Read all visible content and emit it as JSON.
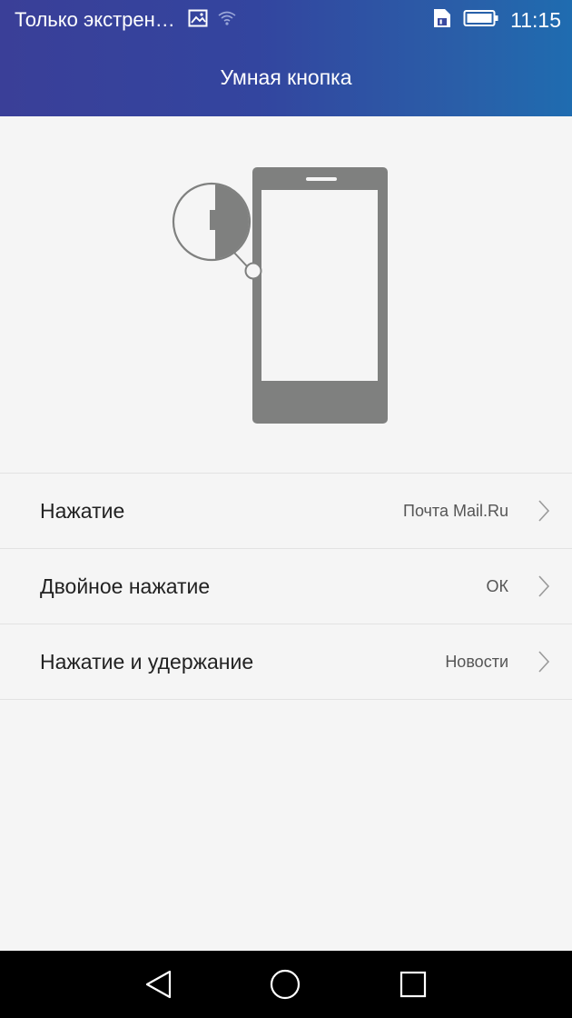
{
  "status_bar": {
    "carrier": "Только экстрен…",
    "time": "11:15",
    "icons": [
      "image-notification-icon",
      "wifi-icon",
      "sim-icon",
      "battery-icon"
    ]
  },
  "header": {
    "title": "Умная кнопка",
    "gradient_colors": [
      "#3a3f98",
      "#1f6cb0"
    ]
  },
  "illustration": {
    "icon": "phone-smart-button-illustration",
    "color": "#7f807f"
  },
  "settings": {
    "items": [
      {
        "label": "Нажатие",
        "value": "Почта Mail.Ru"
      },
      {
        "label": "Двойное нажатие",
        "value": "ОК"
      },
      {
        "label": "Нажатие и удержание",
        "value": "Новости"
      }
    ]
  },
  "navigation_bar": {
    "buttons": [
      "back-icon",
      "home-icon",
      "recents-icon"
    ]
  }
}
